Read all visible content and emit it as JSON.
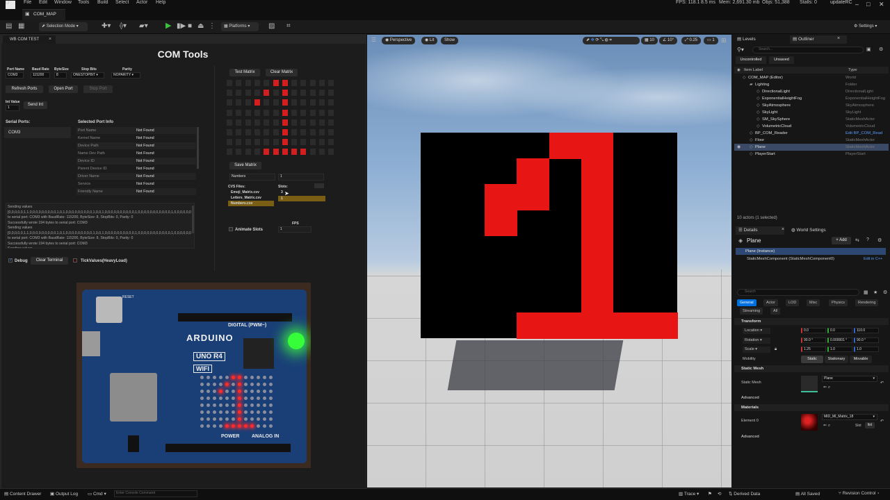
{
  "menu": {
    "logo": "U",
    "items": [
      "File",
      "Edit",
      "Window",
      "Tools",
      "Build",
      "Select",
      "Actor",
      "Help"
    ],
    "stats": [
      "FPS: 118.1",
      "8.5 ms",
      "Mem: 2,691.30 mb",
      "Objs: 51,388",
      "Stalls: 0"
    ],
    "project": "updateRC"
  },
  "map_tab": "COM_MAP",
  "toolbar": {
    "selection_mode": "Selection Mode",
    "platforms": "Platforms",
    "settings": "Settings"
  },
  "widget": {
    "tab": "WB COM TEST",
    "title": "COM Tools",
    "port_name_label": "Port Name",
    "port_name": "COM3",
    "baud_label": "Baud Rate",
    "baud": "115200",
    "bytesize_label": "ByteSize",
    "bytesize": "8",
    "stopbits_label": "Stop Bits",
    "stopbits": "ONESTOPBIT",
    "parity_label": "Parity",
    "parity": "NOPARITY",
    "refresh": "Refresh Ports",
    "open": "Open Port",
    "stop": "Stop Port",
    "int_label": "Int Value",
    "int_value": "1",
    "send": "Send Int",
    "serial_label": "Serial Ports:",
    "serial_item": "COM3",
    "selected_label": "Selected Port Info",
    "info": [
      {
        "k": "Port Name",
        "v": "Not Found"
      },
      {
        "k": "Kernel Name",
        "v": "Not Found"
      },
      {
        "k": "Device Path",
        "v": "Not Found"
      },
      {
        "k": "Name Dev Path",
        "v": "Not Found"
      },
      {
        "k": "Device ID",
        "v": "Not Found"
      },
      {
        "k": "Parent Device ID",
        "v": "Not Found"
      },
      {
        "k": "Driver Name",
        "v": "Not Found"
      },
      {
        "k": "Service",
        "v": "Not Found"
      },
      {
        "k": "Friendly Name",
        "v": "Not Found"
      }
    ],
    "terminal": [
      "Sending values",
      "[0,0,0,0,0,1,1,0,0,0,0,0,0,0,0,0,1,0,1,0,0,0,0,0,0,0,0,0,1,0,0,1,0,0,0,0,0,0,0,0,0,0,1,0,0,0,0,0,0,0,0,0,0,0,1,0,0,0,0,0,0",
      "to serial port: COM3 with BaudRate: 115200, ByteSize: 8, StopBits: 0, Parity: 0",
      "Successfully wrote 194 bytes to serial port: COM3",
      "Sending values",
      "[0,0,0,0,0,1,1,0,0,0,0,0,0,0,0,0,1,0,1,0,0,0,0,0,0,0,0,0,1,0,0,1,0,0,0,0,0,0,0,0,0,0,1,0,0,0,0,0,0,0,0,0,0,0,1,0,0,0,0,0,0",
      "to serial port: COM3 with BaudRate: 115200, ByteSize: 8, StopBits: 0, Parity: 0",
      "Successfully wrote 194 bytes to serial port: COM3",
      "Sending values"
    ],
    "debug": "Debug",
    "clear_terminal": "Clear Terminal",
    "tick": "TickValues(HeavyLoad)",
    "test_matrix": "Test Matrix",
    "clear_matrix": "Clear Matrix",
    "save_matrix": "Save Matrix",
    "name_field": "Numbers",
    "slot_field": "1",
    "csv_label": "CVS Files:",
    "slots_label": "Slots:",
    "csv_files": [
      "Emoji_Matrix.csv",
      "Letters_Matrix.csv",
      "Numbers.csv"
    ],
    "slots": [
      "3",
      "1"
    ],
    "fps_label": "FPS",
    "animate": "Animate Slots",
    "fps_value": "1"
  },
  "matrix_grid": {
    "cols": 12,
    "rows": 8,
    "on": [
      [
        5,
        0
      ],
      [
        6,
        0
      ],
      [
        4,
        1
      ],
      [
        6,
        1
      ],
      [
        3,
        2
      ],
      [
        6,
        2
      ],
      [
        6,
        3
      ],
      [
        6,
        4
      ],
      [
        6,
        5
      ],
      [
        6,
        6
      ],
      [
        4,
        7
      ],
      [
        5,
        7
      ],
      [
        6,
        7
      ],
      [
        7,
        7
      ],
      [
        8,
        7
      ]
    ]
  },
  "pixel_screen": {
    "cols": 8,
    "rows": 8,
    "on": [
      [
        4,
        0
      ],
      [
        5,
        0
      ],
      [
        3,
        1
      ],
      [
        5,
        1
      ],
      [
        2,
        2
      ],
      [
        3,
        2
      ],
      [
        5,
        2
      ],
      [
        2,
        3
      ],
      [
        5,
        3
      ],
      [
        5,
        4
      ],
      [
        5,
        5
      ],
      [
        5,
        6
      ],
      [
        3,
        7
      ],
      [
        4,
        7
      ],
      [
        5,
        7
      ],
      [
        6,
        7
      ],
      [
        7,
        7
      ]
    ]
  },
  "board": {
    "brand": "ARDUINO",
    "model": "UNO R4",
    "wifi": "WIFI",
    "digital": "DIGITAL (PWM~)",
    "power": "POWER",
    "analog": "ANALOG IN",
    "reset": "RESET",
    "led_color": "#36ff3a"
  },
  "viewport": {
    "perspective": "Perspective",
    "lit": "Lit",
    "show": "Show",
    "grid": "10",
    "angle": "10°",
    "scale": "0.25",
    "cams": "1"
  },
  "outliner": {
    "levels_tab": "Levels",
    "outliner_tab": "Outliner",
    "search_placeholder": "Search...",
    "uncontrolled": "Uncontrolled",
    "unsaved": "Unsaved",
    "col_label": "Item Label",
    "col_type": "Type",
    "items": [
      {
        "label": "COM_MAP (Editor)",
        "type": "World",
        "indent": 1
      },
      {
        "label": "Lighting",
        "type": "Folder",
        "indent": 2
      },
      {
        "label": "DirectionalLight",
        "type": "DirectionalLight",
        "indent": 3
      },
      {
        "label": "ExponentialHeightFog",
        "type": "ExponentialHeightFog",
        "indent": 3
      },
      {
        "label": "SkyAtmosphere",
        "type": "SkyAtmosphere",
        "indent": 3
      },
      {
        "label": "SkyLight",
        "type": "SkyLight",
        "indent": 3
      },
      {
        "label": "SM_SkySphere",
        "type": "StaticMeshActor",
        "indent": 3
      },
      {
        "label": "VolumetricCloud",
        "type": "VolumetricCloud",
        "indent": 3
      },
      {
        "label": "BP_COM_Reader",
        "type": "Edit BP_COM_Read",
        "indent": 2
      },
      {
        "label": "Floor",
        "type": "StaticMeshActor",
        "indent": 2
      },
      {
        "label": "Plane",
        "type": "StaticMeshActor",
        "indent": 2,
        "selected": true
      },
      {
        "label": "PlayerStart",
        "type": "PlayerStart",
        "indent": 2
      }
    ],
    "count": "10 actors (1 selected)"
  },
  "details": {
    "tab": "Details",
    "world_tab": "World Settings",
    "object": "Plane",
    "add": "+ Add",
    "instance": "Plane (Instance)",
    "component": "StaticMeshComponent (StaticMeshComponent0)",
    "edit_cpp": "Edit in C++",
    "search_placeholder": "Search",
    "tabs": [
      "General",
      "Actor",
      "LOD",
      "Misc",
      "Physics",
      "Rendering"
    ],
    "tabs2": [
      "Streaming",
      "All"
    ],
    "transform": "Transform",
    "location": "Location",
    "loc": [
      "0.0",
      "0.0",
      "110.0"
    ],
    "rotation": "Rotation",
    "rot": [
      "90.0 °",
      "0.000001 °",
      "90.0 °"
    ],
    "scale": "Scale",
    "scl": [
      "1.25",
      "1.0",
      "1.0"
    ],
    "mobility": "Mobility",
    "mob": [
      "Static",
      "Stationary",
      "Movable"
    ],
    "static_mesh_sec": "Static Mesh",
    "static_mesh_label": "Static Mesh",
    "mesh": "Plane",
    "advanced": "Advanced",
    "materials": "Materials",
    "element": "Element 0",
    "material": "MID_MI_Matrix_18",
    "slot": "Slot",
    "list": "list"
  },
  "statusbar": {
    "content": "Content Drawer",
    "output": "Output Log",
    "cmd": "Cmd",
    "console_placeholder": "Enter Console Command",
    "trace": "Trace",
    "derived": "Derived Data",
    "saved": "All Saved",
    "revision": "Revision Control"
  },
  "colors": {
    "accent": "#0070e0",
    "led_red": "#d21e1e",
    "screen_red": "#e81515"
  }
}
